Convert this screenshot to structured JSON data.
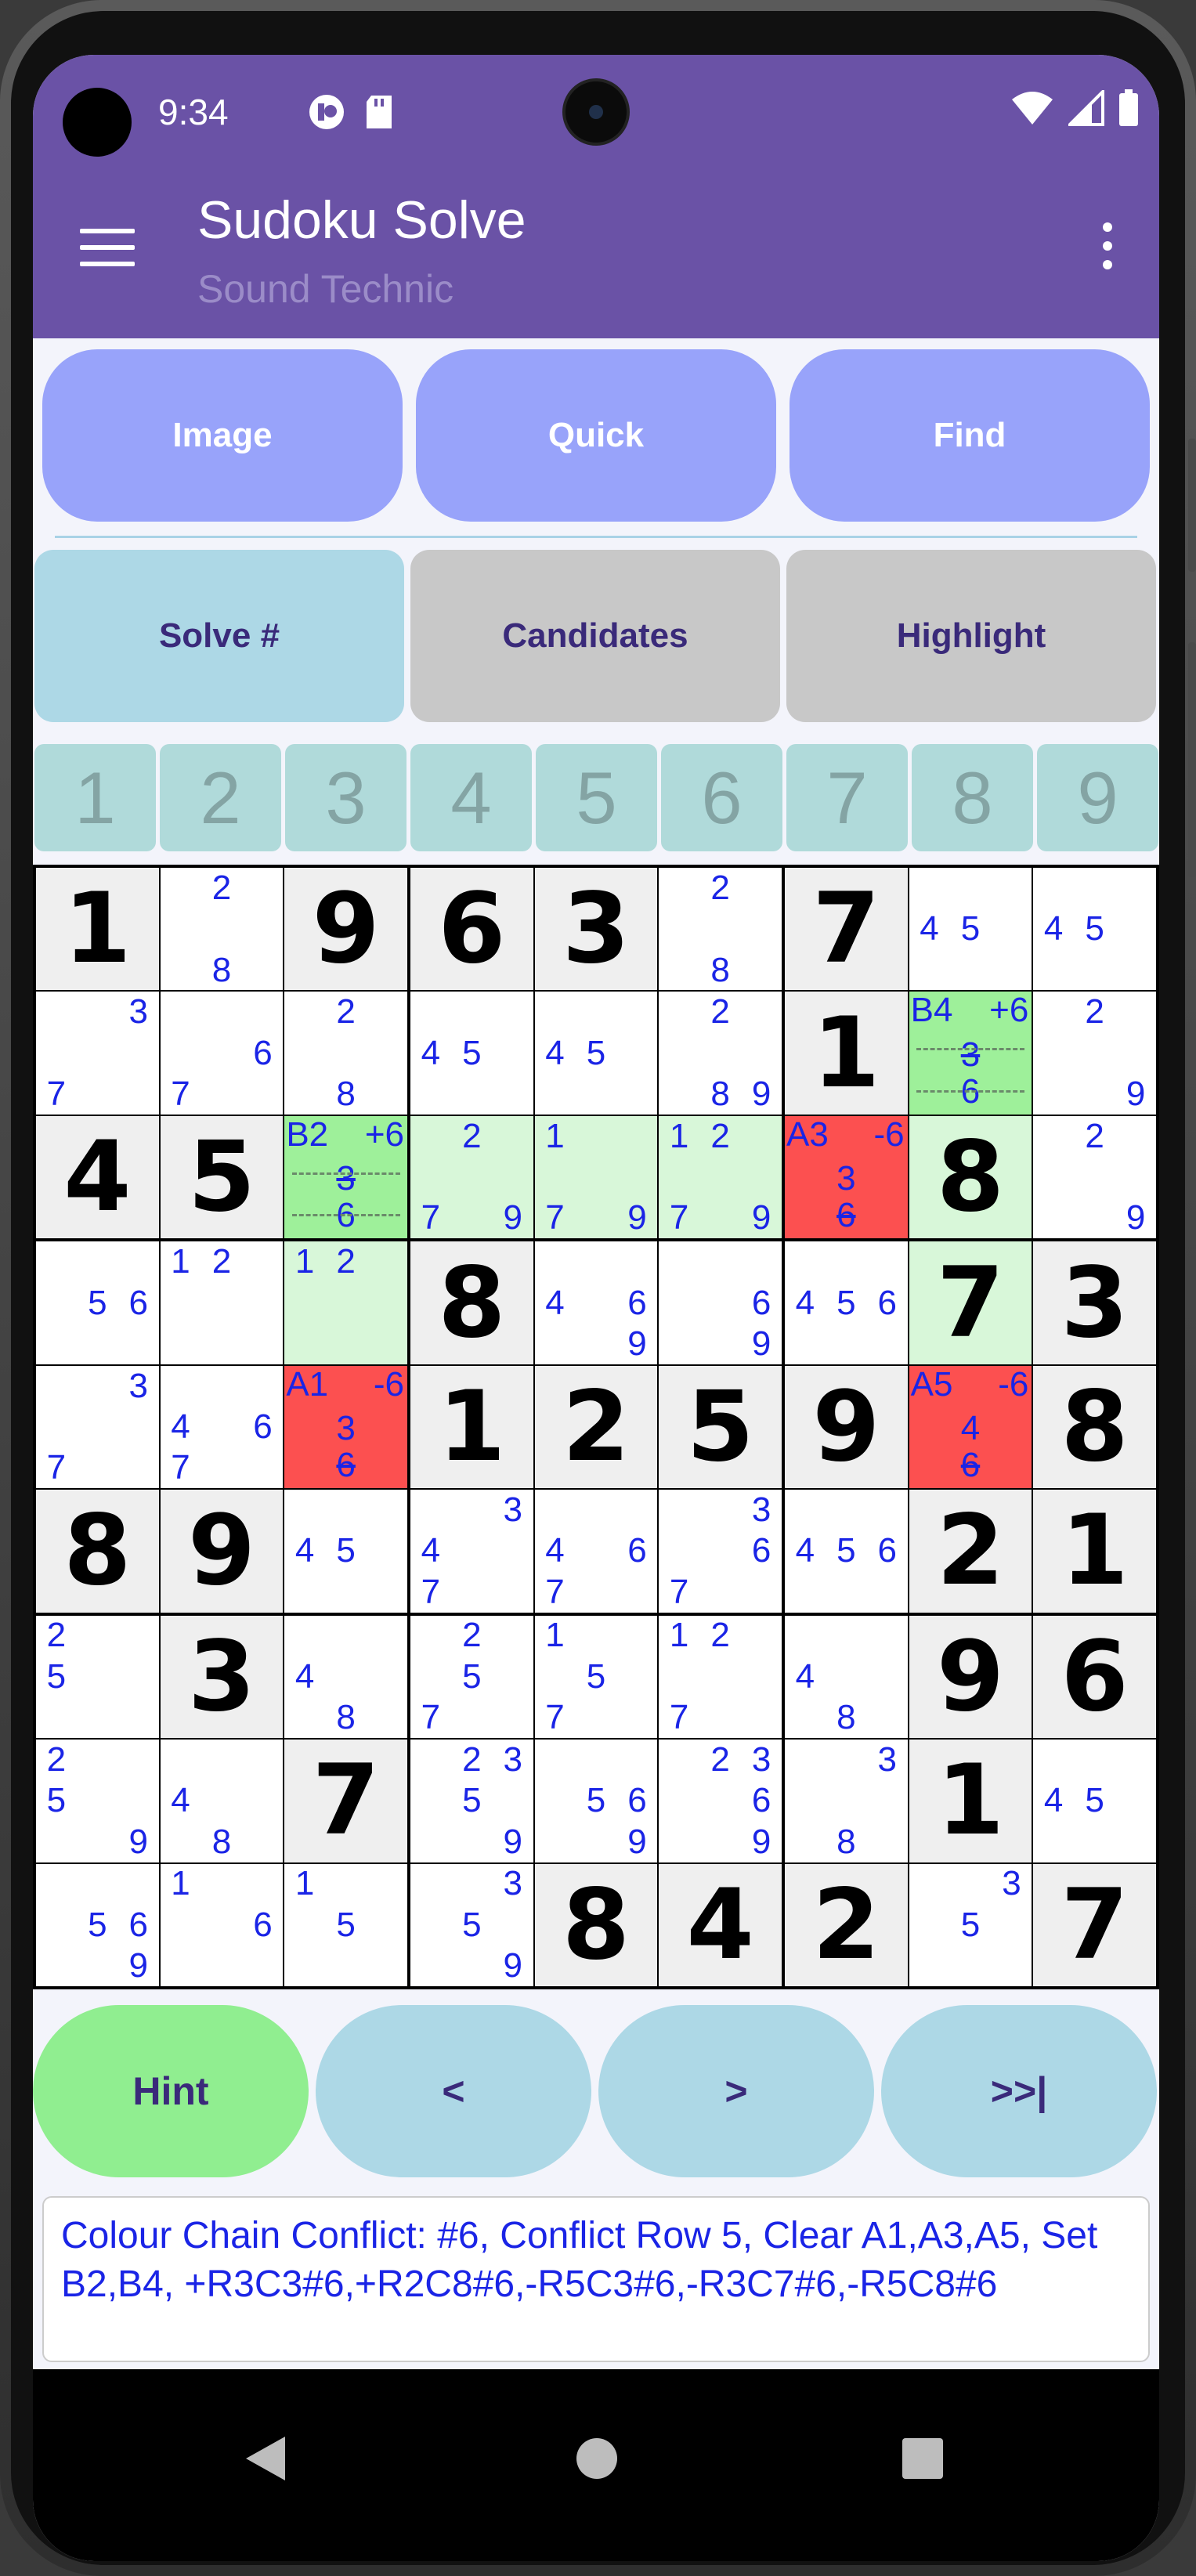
{
  "status": {
    "time": "9:34"
  },
  "app": {
    "title": "Sudoku Solve",
    "subtitle": "Sound Technic"
  },
  "top_buttons": [
    "Image",
    "Quick",
    "Find"
  ],
  "mode_buttons": [
    "Solve #",
    "Candidates",
    "Highlight"
  ],
  "number_buttons": [
    "1",
    "2",
    "3",
    "4",
    "5",
    "6",
    "7",
    "8",
    "9"
  ],
  "grid": [
    [
      {
        "v": "1",
        "bg": "given"
      },
      {
        "c": [
          "",
          "2",
          "",
          "",
          "",
          "",
          "",
          "8",
          ""
        ],
        "bg": "white"
      },
      {
        "v": "9",
        "bg": "given"
      },
      {
        "v": "6",
        "bg": "given"
      },
      {
        "v": "3",
        "bg": "given"
      },
      {
        "c": [
          "",
          "2",
          "",
          "",
          "",
          "",
          "",
          "8",
          ""
        ],
        "bg": "white"
      },
      {
        "v": "7",
        "bg": "given"
      },
      {
        "c": [
          "",
          "",
          "",
          "4",
          "5",
          "",
          "",
          "",
          ""
        ],
        "bg": "white"
      },
      {
        "c": [
          "",
          "",
          "",
          "4",
          "5",
          "",
          "",
          "",
          ""
        ],
        "bg": "white"
      }
    ],
    [
      {
        "c": [
          "",
          "",
          "3",
          "",
          "",
          "",
          "7",
          "",
          ""
        ],
        "bg": "white"
      },
      {
        "c": [
          "",
          "",
          "",
          "",
          "",
          "6",
          "7",
          "",
          ""
        ],
        "bg": "white"
      },
      {
        "c": [
          "",
          "2",
          "",
          "",
          "",
          "",
          "",
          "8",
          ""
        ],
        "bg": "white"
      },
      {
        "c": [
          "",
          "",
          "",
          "4",
          "5",
          "",
          "",
          "",
          ""
        ],
        "bg": "white"
      },
      {
        "c": [
          "",
          "",
          "",
          "4",
          "5",
          "",
          "",
          "",
          ""
        ],
        "bg": "white"
      },
      {
        "c": [
          "",
          "2",
          "",
          "",
          "",
          "",
          "",
          "8",
          "9"
        ],
        "bg": "white"
      },
      {
        "v": "1",
        "bg": "given"
      },
      {
        "chain": {
          "label": "B4",
          "op": "+6",
          "mid": "3",
          "bot": "6",
          "strike": "mid"
        },
        "bg": "green"
      },
      {
        "c": [
          "",
          "2",
          "",
          "",
          "",
          "",
          "",
          "",
          "9"
        ],
        "bg": "white"
      }
    ],
    [
      {
        "v": "4",
        "bg": "given"
      },
      {
        "v": "5",
        "bg": "given"
      },
      {
        "chain": {
          "label": "B2",
          "op": "+6",
          "mid": "3",
          "bot": "6",
          "strike": "mid"
        },
        "bg": "green"
      },
      {
        "c": [
          "",
          "2",
          "",
          "",
          "",
          "",
          "7",
          "",
          "9"
        ],
        "bg": "lg"
      },
      {
        "c": [
          "1",
          "",
          "",
          "",
          "",
          "",
          "7",
          "",
          "9"
        ],
        "bg": "lg"
      },
      {
        "c": [
          "1",
          "2",
          "",
          "",
          "",
          "",
          "7",
          "",
          "9"
        ],
        "bg": "lg"
      },
      {
        "chain": {
          "label": "A3",
          "op": "-6",
          "mid": "3",
          "bot": "6",
          "strike": "bot"
        },
        "bg": "red"
      },
      {
        "v": "8",
        "bg": "lg"
      },
      {
        "c": [
          "",
          "2",
          "",
          "",
          "",
          "",
          "",
          "",
          "9"
        ],
        "bg": "white"
      }
    ],
    [
      {
        "c": [
          "",
          "",
          "",
          "",
          "5",
          "6",
          "",
          "",
          ""
        ],
        "bg": "white"
      },
      {
        "c": [
          "1",
          "2",
          "",
          "",
          "",
          "",
          "",
          "",
          ""
        ],
        "bg": "white"
      },
      {
        "c": [
          "1",
          "2",
          "",
          "",
          "",
          "",
          "",
          "",
          ""
        ],
        "bg": "lg"
      },
      {
        "v": "8",
        "bg": "given"
      },
      {
        "c": [
          "",
          "",
          "",
          "4",
          "",
          "6",
          "",
          "",
          "9"
        ],
        "bg": "white"
      },
      {
        "c": [
          "",
          "",
          "",
          "",
          "",
          "6",
          "",
          "",
          "9"
        ],
        "bg": "white"
      },
      {
        "c": [
          "",
          "",
          "",
          "4",
          "5",
          "6",
          "",
          "",
          ""
        ],
        "bg": "white"
      },
      {
        "v": "7",
        "bg": "lg"
      },
      {
        "v": "3",
        "bg": "given"
      }
    ],
    [
      {
        "c": [
          "",
          "",
          "3",
          "",
          "",
          "",
          "7",
          "",
          ""
        ],
        "bg": "white"
      },
      {
        "c": [
          "",
          "",
          "",
          "4",
          "",
          "6",
          "7",
          "",
          ""
        ],
        "bg": "white"
      },
      {
        "chain": {
          "label": "A1",
          "op": "-6",
          "mid": "3",
          "bot": "6",
          "strike": "bot"
        },
        "bg": "red"
      },
      {
        "v": "1",
        "bg": "given"
      },
      {
        "v": "2",
        "bg": "given"
      },
      {
        "v": "5",
        "bg": "given"
      },
      {
        "v": "9",
        "bg": "given"
      },
      {
        "chain": {
          "label": "A5",
          "op": "-6",
          "mid": "4",
          "bot": "6",
          "strike": "bot"
        },
        "bg": "red"
      },
      {
        "v": "8",
        "bg": "given"
      }
    ],
    [
      {
        "v": "8",
        "bg": "given"
      },
      {
        "v": "9",
        "bg": "given"
      },
      {
        "c": [
          "",
          "",
          "",
          "4",
          "5",
          "",
          "",
          "",
          ""
        ],
        "bg": "white"
      },
      {
        "c": [
          "",
          "",
          "3",
          "4",
          "",
          "",
          "7",
          "",
          ""
        ],
        "bg": "white"
      },
      {
        "c": [
          "",
          "",
          "",
          "4",
          "",
          "6",
          "7",
          "",
          ""
        ],
        "bg": "white"
      },
      {
        "c": [
          "",
          "",
          "3",
          "",
          "",
          "6",
          "7",
          "",
          ""
        ],
        "bg": "white"
      },
      {
        "c": [
          "",
          "",
          "",
          "4",
          "5",
          "6",
          "",
          "",
          ""
        ],
        "bg": "white"
      },
      {
        "v": "2",
        "bg": "given"
      },
      {
        "v": "1",
        "bg": "given"
      }
    ],
    [
      {
        "c": [
          "2",
          "",
          "",
          "5",
          "",
          "",
          "",
          "",
          ""
        ],
        "bg": "white"
      },
      {
        "v": "3",
        "bg": "given"
      },
      {
        "c": [
          "",
          "",
          "",
          "4",
          "",
          "",
          "",
          "8",
          ""
        ],
        "bg": "white"
      },
      {
        "c": [
          "",
          "2",
          "",
          "",
          "5",
          "",
          "7",
          "",
          ""
        ],
        "bg": "white"
      },
      {
        "c": [
          "1",
          "",
          "",
          "",
          "5",
          "",
          "7",
          "",
          ""
        ],
        "bg": "white"
      },
      {
        "c": [
          "1",
          "2",
          "",
          "",
          "",
          "",
          "7",
          "",
          ""
        ],
        "bg": "white"
      },
      {
        "c": [
          "",
          "",
          "",
          "4",
          "",
          "",
          "",
          "8",
          ""
        ],
        "bg": "white"
      },
      {
        "v": "9",
        "bg": "given"
      },
      {
        "v": "6",
        "bg": "given"
      }
    ],
    [
      {
        "c": [
          "2",
          "",
          "",
          "5",
          "",
          "",
          "",
          "",
          "9"
        ],
        "bg": "white"
      },
      {
        "c": [
          "",
          "",
          "",
          "4",
          "",
          "",
          "",
          "8",
          ""
        ],
        "bg": "white"
      },
      {
        "v": "7",
        "bg": "given"
      },
      {
        "c": [
          "",
          "2",
          "3",
          "",
          "5",
          "",
          "",
          "",
          "9"
        ],
        "bg": "white"
      },
      {
        "c": [
          "",
          "",
          "",
          "",
          "5",
          "6",
          "",
          "",
          "9"
        ],
        "bg": "white"
      },
      {
        "c": [
          "",
          "2",
          "3",
          "",
          "",
          "6",
          "",
          "",
          "9"
        ],
        "bg": "white"
      },
      {
        "c": [
          "",
          "",
          "3",
          "",
          "",
          "",
          "",
          "8",
          ""
        ],
        "bg": "white"
      },
      {
        "v": "1",
        "bg": "given"
      },
      {
        "c": [
          "",
          "",
          "",
          "4",
          "5",
          "",
          "",
          "",
          ""
        ],
        "bg": "white"
      }
    ],
    [
      {
        "c": [
          "",
          "",
          "",
          "",
          "5",
          "6",
          "",
          "",
          "9"
        ],
        "bg": "white"
      },
      {
        "c": [
          "1",
          "",
          "",
          "",
          "",
          "6",
          "",
          "",
          ""
        ],
        "bg": "white"
      },
      {
        "c": [
          "1",
          "",
          "",
          "",
          "5",
          "",
          "",
          "",
          ""
        ],
        "bg": "white"
      },
      {
        "c": [
          "",
          "",
          "3",
          "",
          "5",
          "",
          "",
          "",
          "9"
        ],
        "bg": "white"
      },
      {
        "v": "8",
        "bg": "given"
      },
      {
        "v": "4",
        "bg": "given"
      },
      {
        "v": "2",
        "bg": "given"
      },
      {
        "c": [
          "",
          "",
          "3",
          "",
          "5",
          "",
          "",
          "",
          ""
        ],
        "bg": "white"
      },
      {
        "v": "7",
        "bg": "given"
      }
    ]
  ],
  "nav_buttons": [
    "Hint",
    "<",
    ">",
    ">>|"
  ],
  "hint_message": "Colour Chain Conflict: #6, Conflict Row 5, Clear A1,A3,A5, Set B2,B4, +R3C3#6,+R2C8#6,-R5C3#6,-R3C7#6,-R5C8#6",
  "colors": {
    "app_bar": "#6a52a6",
    "top_button": "#98a3fa",
    "mode_active": "#add8e6",
    "mode_inactive": "#c8c8c8",
    "hint_button": "#90ee90",
    "nav_button": "#add8e6",
    "candidate": "#1a24e6",
    "chain_set": "#9ef09a",
    "chain_clear": "#fc5050"
  }
}
